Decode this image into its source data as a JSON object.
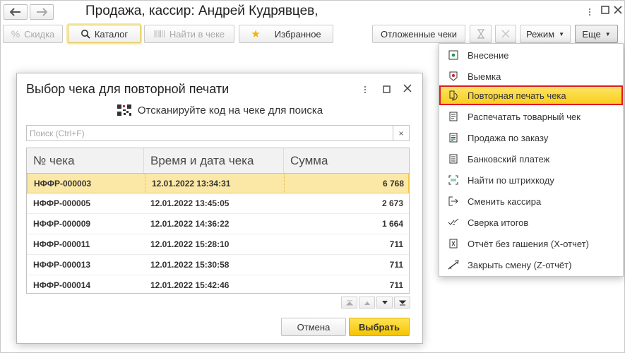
{
  "window": {
    "title": "Продажа, кассир: Андрей Кудрявцев,"
  },
  "toolbar": {
    "discount": "Скидка",
    "catalog": "Каталог",
    "find_in_receipt": "Найти в чеке",
    "favorites": "Избранное",
    "deferred": "Отложенные чеки",
    "mode": "Режим",
    "more": "Еще"
  },
  "dialog": {
    "title": "Выбор чека для повторной печати",
    "scan_hint": "Отсканируйте код на чеке для поиска",
    "search_placeholder": "Поиск (Ctrl+F)",
    "search_clear": "×",
    "columns": [
      "№ чека",
      "Время и дата чека",
      "Сумма"
    ],
    "rows": [
      {
        "num": "НФФР-000003",
        "datetime": "12.01.2022 13:34:31",
        "sum": "6 768",
        "selected": true
      },
      {
        "num": "НФФР-000005",
        "datetime": "12.01.2022 13:45:05",
        "sum": "2 673"
      },
      {
        "num": "НФФР-000009",
        "datetime": "12.01.2022 14:36:22",
        "sum": "1 664"
      },
      {
        "num": "НФФР-000011",
        "datetime": "12.01.2022 15:28:10",
        "sum": "711"
      },
      {
        "num": "НФФР-000013",
        "datetime": "12.01.2022 15:30:58",
        "sum": "711"
      },
      {
        "num": "НФФР-000014",
        "datetime": "12.01.2022 15:42:46",
        "sum": "711"
      }
    ],
    "cancel": "Отмена",
    "select": "Выбрать"
  },
  "menu": {
    "items": [
      {
        "label": "Внесение",
        "icon": "deposit-icon"
      },
      {
        "label": "Выемка",
        "icon": "withdrawal-icon"
      },
      {
        "label": "Повторная печать чека",
        "icon": "reprint-icon",
        "highlighted": true
      },
      {
        "label": "Распечатать товарный чек",
        "icon": "sales-receipt-icon"
      },
      {
        "label": "Продажа по заказу",
        "icon": "order-icon"
      },
      {
        "label": "Банковский платеж",
        "icon": "bank-payment-icon"
      },
      {
        "label": "Найти по штрихкоду",
        "icon": "barcode-scan-icon"
      },
      {
        "label": "Сменить кассира",
        "icon": "change-cashier-icon"
      },
      {
        "label": "Сверка итогов",
        "icon": "reconciliation-icon"
      },
      {
        "label": "Отчёт без гашения (X-отчет)",
        "icon": "x-report-icon"
      },
      {
        "label": "Закрыть смену (Z-отчёт)",
        "icon": "close-shift-icon"
      }
    ]
  },
  "colors": {
    "accent_yellow": "#f5c400",
    "highlight_red": "#e11b1b",
    "selected_row": "#fbe8a6"
  }
}
